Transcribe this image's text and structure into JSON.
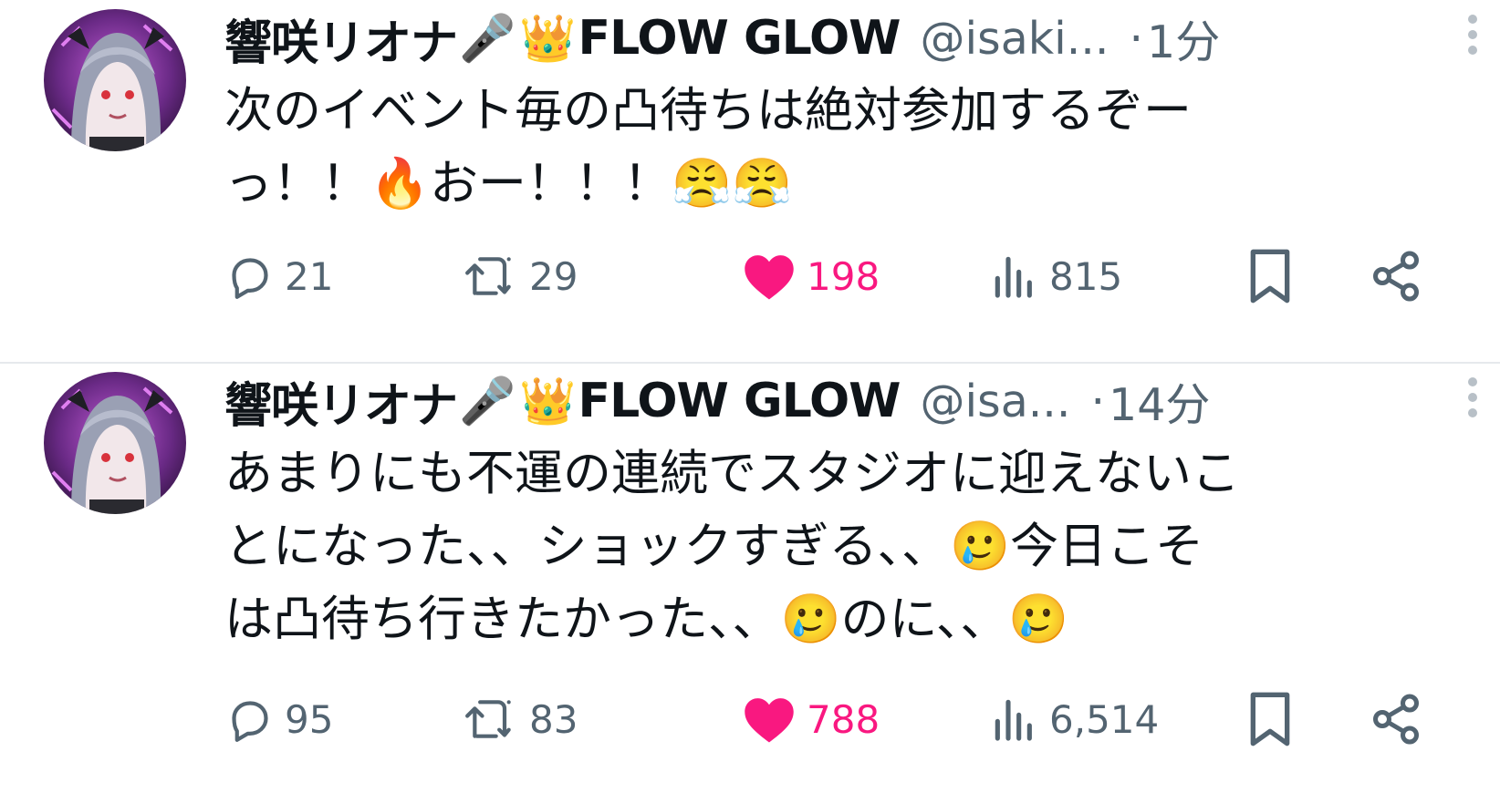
{
  "tweets": [
    {
      "author": {
        "name": "響咲リオナ",
        "mic_emoji": "🎤",
        "crown_emoji": "👑",
        "group": "FLOW GLOW",
        "handle": "@isaki...",
        "time": "1分"
      },
      "text": "次のイベント毎の凸待ちは絶対参加するぞー\nっ！！🔥おー！！！😤😤",
      "stats": {
        "replies": "21",
        "retweets": "29",
        "likes": "198",
        "views": "815"
      },
      "liked": true
    },
    {
      "author": {
        "name": "響咲リオナ",
        "mic_emoji": "🎤",
        "crown_emoji": "👑",
        "group": "FLOW GLOW",
        "handle": "@isa...",
        "time": "14分"
      },
      "text": "あまりにも不運の連続でスタジオに迎えないこ\nとになった、、ショックすぎる、、🥲今日こそ\nは凸待ち行きたかった、、🥲のに、、🥲",
      "stats": {
        "replies": "95",
        "retweets": "83",
        "likes": "788",
        "views": "6,514"
      },
      "liked": true
    }
  ],
  "separator": "·",
  "colors": {
    "like_active": "#f91880",
    "muted": "#536471",
    "text": "#0f1419",
    "divider": "#e6e9ec"
  },
  "icons": [
    "reply-icon",
    "retweet-icon",
    "heart-icon",
    "views-icon",
    "bookmark-icon",
    "share-icon",
    "more-icon"
  ]
}
